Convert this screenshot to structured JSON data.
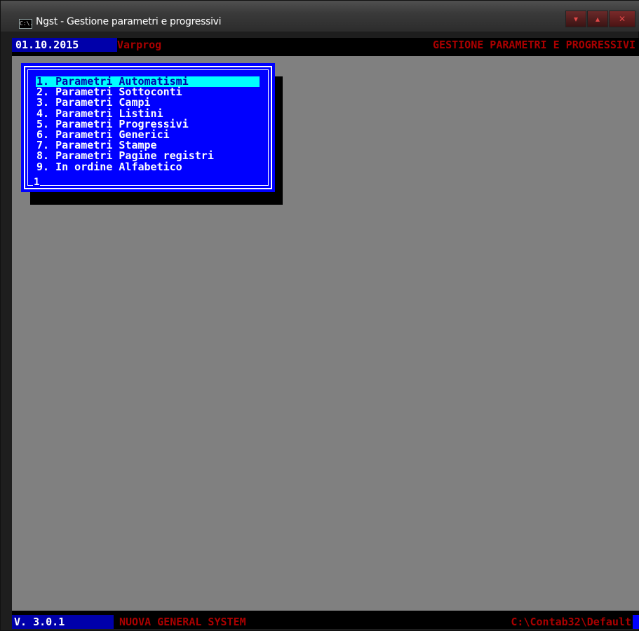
{
  "window": {
    "title": "Ngst - Gestione parametri e progressivi",
    "icon_text": "C:\\."
  },
  "header": {
    "date": "01.10.2015",
    "program": "Varprog",
    "title": "GESTIONE PARAMETRI E PROGRESSIVI"
  },
  "menu": {
    "items": [
      "1. Parametri Automatismi",
      "2. Parametri Sottoconti",
      "3. Parametri Campi",
      "4. Parametri Listini",
      "5. Parametri Progressivi",
      "6. Parametri Generici",
      "7. Parametri Stampe",
      "8. Parametri Pagine registri",
      "9. In ordine Alfabetico"
    ],
    "selected_index": 0,
    "page": "1"
  },
  "footer": {
    "version": "V. 3.0.1",
    "system": "NUOVA GENERAL SYSTEM",
    "path": "C:\\Contab32\\Default"
  },
  "colors": {
    "console_bg": "#808080",
    "menu_bg": "#0000ff",
    "selected_bg": "#00ffff",
    "bar_blue": "#0000aa",
    "red_text": "#aa0000"
  }
}
